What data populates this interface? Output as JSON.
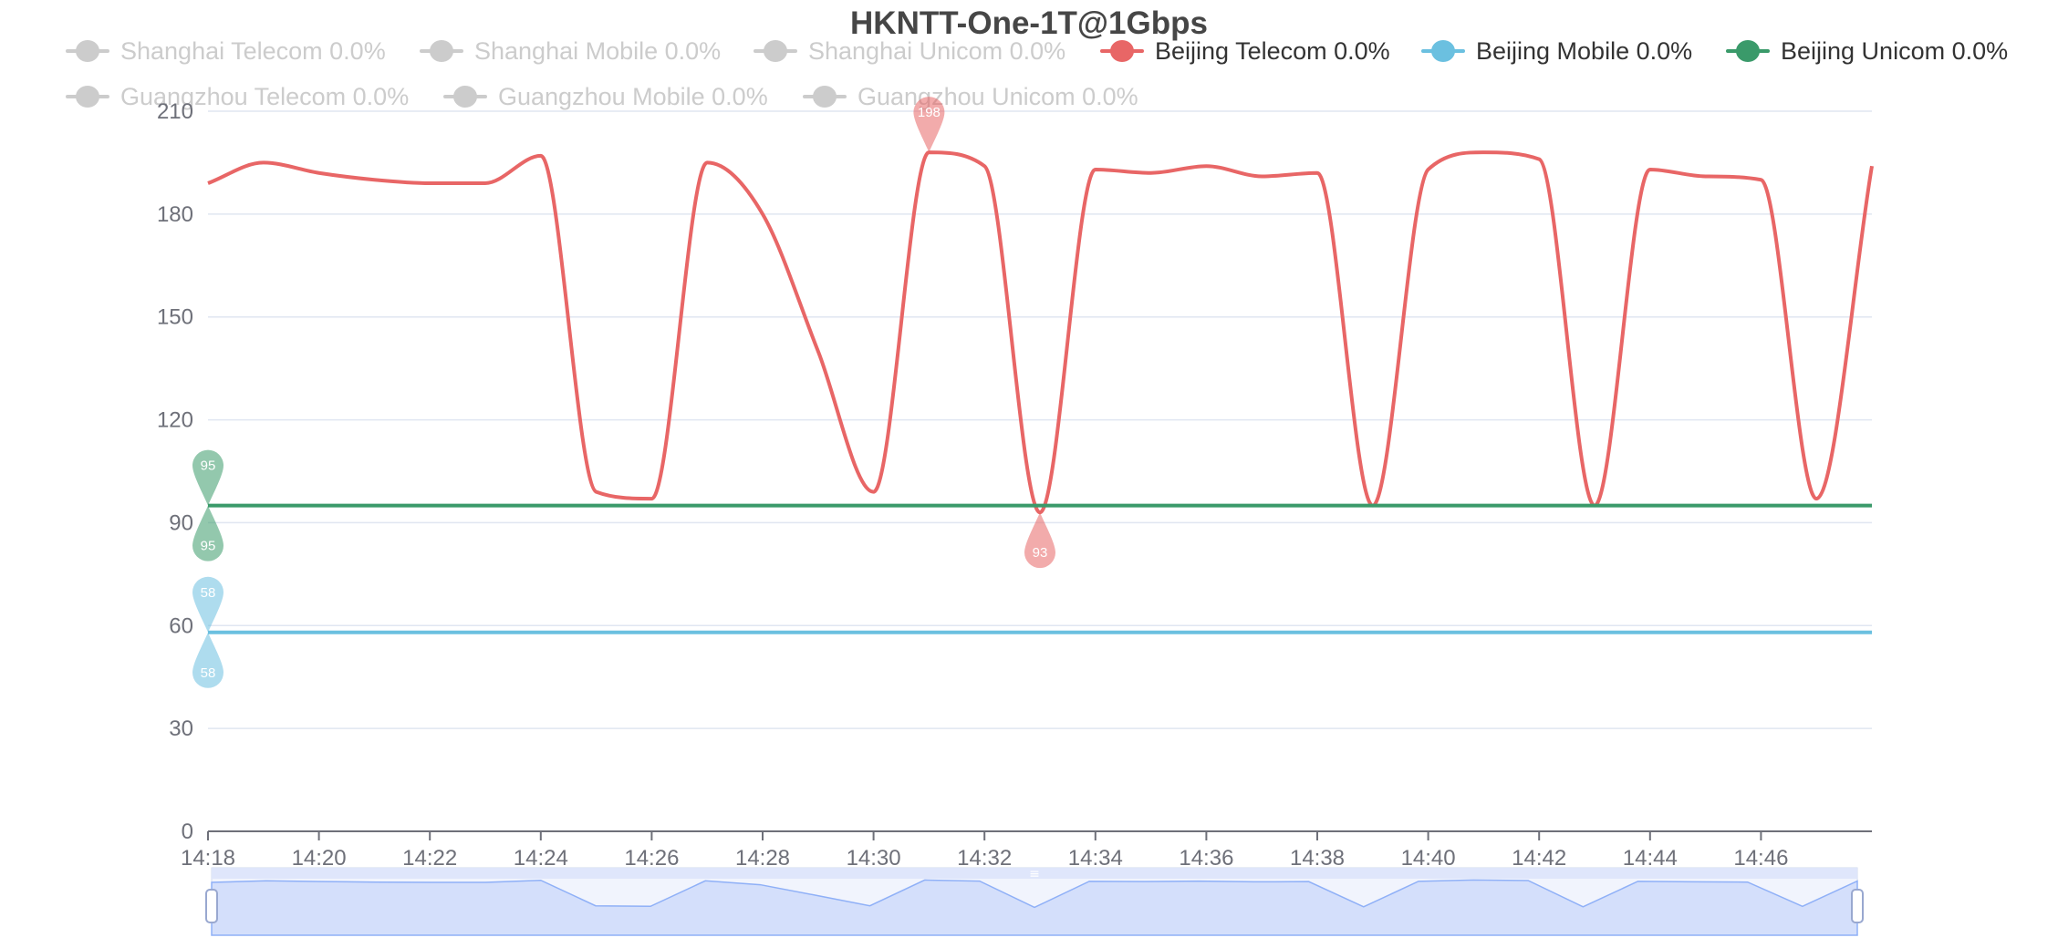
{
  "chart_data": {
    "type": "line",
    "title": "HKNTT-One-1T@1Gbps",
    "legend_position": "top",
    "ylim": [
      0,
      210
    ],
    "y_ticks": [
      "0",
      "30",
      "60",
      "90",
      "120",
      "150",
      "180",
      "210"
    ],
    "x_ticks": [
      "14:18",
      "14:20",
      "14:22",
      "14:24",
      "14:26",
      "14:28",
      "14:30",
      "14:32",
      "14:34",
      "14:36",
      "14:38",
      "14:40",
      "14:42",
      "14:44",
      "14:46"
    ],
    "xlim": [
      "14:18",
      "14:48"
    ],
    "grid": true,
    "legend": [
      {
        "label": "Shanghai Telecom 0.0%",
        "active": false,
        "color": "#cccccc"
      },
      {
        "label": "Shanghai Mobile 0.0%",
        "active": false,
        "color": "#cccccc"
      },
      {
        "label": "Shanghai Unicom 0.0%",
        "active": false,
        "color": "#cccccc"
      },
      {
        "label": "Beijing Telecom 0.0%",
        "active": true,
        "color": "#e86666"
      },
      {
        "label": "Beijing Mobile 0.0%",
        "active": true,
        "color": "#6bc0e0"
      },
      {
        "label": "Beijing Unicom 0.0%",
        "active": true,
        "color": "#3a9a6a"
      },
      {
        "label": "Guangzhou Telecom 0.0%",
        "active": false,
        "color": "#cccccc"
      },
      {
        "label": "Guangzhou Mobile 0.0%",
        "active": false,
        "color": "#cccccc"
      },
      {
        "label": "Guangzhou Unicom 0.0%",
        "active": false,
        "color": "#cccccc"
      }
    ],
    "series": [
      {
        "name": "Beijing Telecom",
        "color": "#e86666",
        "x": [
          "14:18",
          "14:19",
          "14:20",
          "14:21",
          "14:22",
          "14:23",
          "14:24",
          "14:25",
          "14:26",
          "14:27",
          "14:28",
          "14:29",
          "14:30",
          "14:31",
          "14:32",
          "14:33",
          "14:34",
          "14:35",
          "14:36",
          "14:37",
          "14:38",
          "14:39",
          "14:40",
          "14:41",
          "14:42",
          "14:43",
          "14:44",
          "14:45",
          "14:46",
          "14:47",
          "14:48"
        ],
        "values": [
          189,
          195,
          192,
          190,
          189,
          189,
          197,
          99,
          97,
          195,
          180,
          140,
          99,
          198,
          194,
          93,
          193,
          192,
          194,
          191,
          192,
          95,
          193,
          198,
          196,
          95,
          193,
          191,
          190,
          97,
          194
        ],
        "markers": [
          {
            "type": "max",
            "label": "198",
            "x": "14:31",
            "value": 198
          },
          {
            "type": "min",
            "label": "93",
            "x": "14:33",
            "value": 93
          }
        ]
      },
      {
        "name": "Beijing Mobile",
        "color": "#6bc0e0",
        "x": [
          "14:18",
          "14:48"
        ],
        "values": [
          58,
          58
        ],
        "markers": [
          {
            "type": "max",
            "label": "58",
            "x": "14:18",
            "value": 58
          },
          {
            "type": "min",
            "label": "58",
            "x": "14:18",
            "value": 58
          }
        ]
      },
      {
        "name": "Beijing Unicom",
        "color": "#3a9a6a",
        "x": [
          "14:18",
          "14:48"
        ],
        "values": [
          95,
          95
        ],
        "markers": [
          {
            "type": "max",
            "label": "95",
            "x": "14:18",
            "value": 95
          },
          {
            "type": "min",
            "label": "95",
            "x": "14:18",
            "value": 95
          }
        ]
      }
    ],
    "data_zoom": {
      "start_percent": 0,
      "end_percent": 100,
      "handle_glyph": "≡"
    }
  },
  "colors": {
    "axis_text": "#6e7079",
    "grid": "#e0e6f1",
    "axis_line": "#6e7079",
    "title": "#464646",
    "legend_active_text": "#333333",
    "legend_inactive_text": "#cccccc",
    "zoom_fill": "#dfe6fb",
    "zoom_area": "#c7d5fa",
    "zoom_line": "#8fb0f7",
    "zoom_handle_border": "#99a8d0"
  }
}
